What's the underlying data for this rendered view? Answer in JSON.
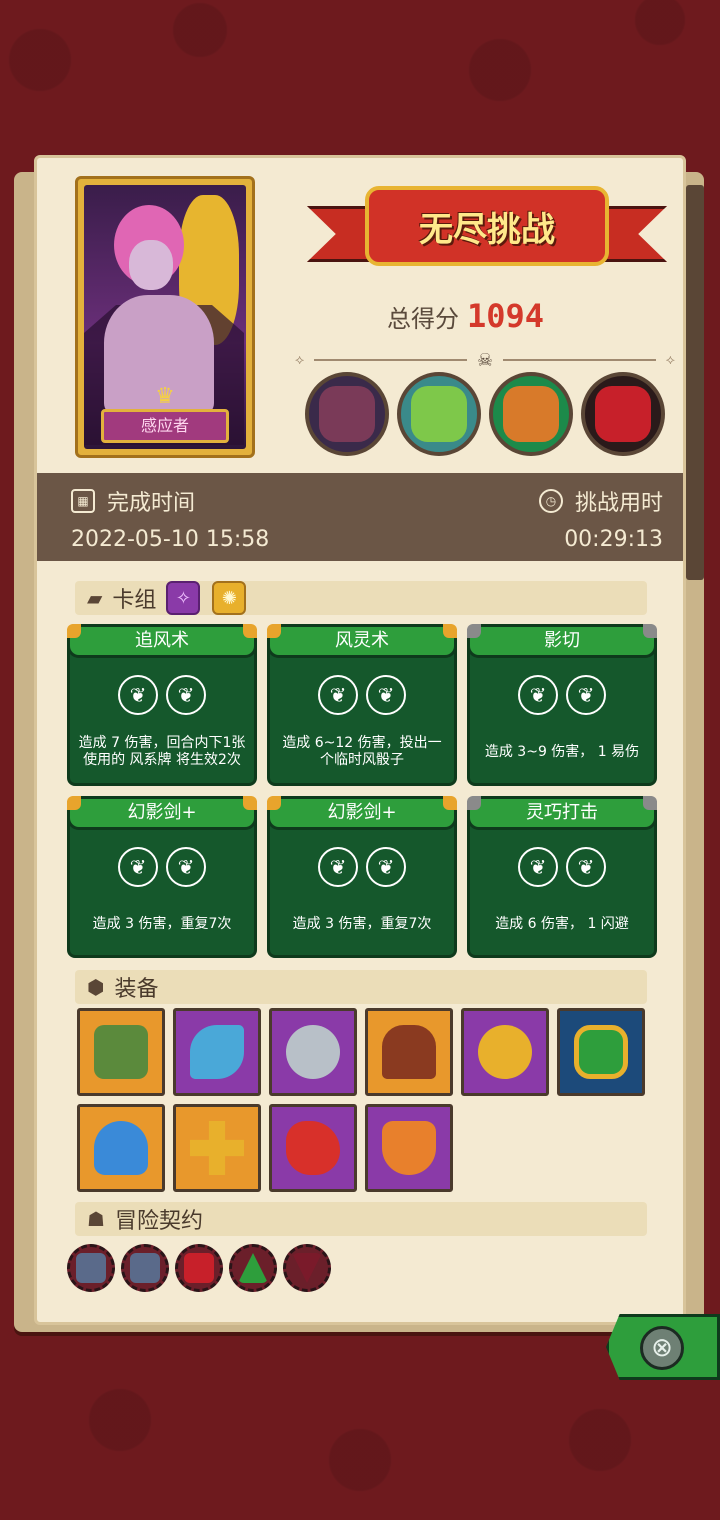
{
  "hero": {
    "name": "感应者",
    "crown_icon": "crown-icon"
  },
  "banner": {
    "title": "无尽挑战"
  },
  "score": {
    "label": "总得分",
    "value": "1094"
  },
  "bosses": [
    {
      "icon": "boss-stone-golem-icon",
      "color": "#7a3a58"
    },
    {
      "icon": "boss-dragon-icon",
      "color": "#7ec84a"
    },
    {
      "icon": "boss-fish-icon",
      "color": "#d87a2a"
    },
    {
      "icon": "boss-red-hat-icon",
      "color": "#c7202a"
    }
  ],
  "info": {
    "completion_label": "完成时间",
    "completion_value": "2022-05-10 15:58",
    "duration_label": "挑战用时",
    "duration_value": "00:29:13"
  },
  "deck": {
    "label": "卡组",
    "cards": [
      {
        "title": "追风术",
        "desc": "造成 7 伤害，回合内下1张使用的 风系牌 将生效2次",
        "corner": "gold"
      },
      {
        "title": "风灵术",
        "desc": "造成 6~12 伤害，投出一个临时风骰子",
        "corner": "gold"
      },
      {
        "title": "影切",
        "desc": "造成 3~9 伤害， 1 易伤",
        "corner": "gray"
      },
      {
        "title": "幻影剑+",
        "desc": "造成 3 伤害，重复7次",
        "corner": "gold"
      },
      {
        "title": "幻影剑+",
        "desc": "造成 3 伤害，重复7次",
        "corner": "gold"
      },
      {
        "title": "灵巧打击",
        "desc": "造成 6 伤害， 1 闪避",
        "corner": "gray"
      }
    ]
  },
  "equipment": {
    "label": "装备",
    "items": [
      {
        "icon": "green-book-icon",
        "bg": "#e8982c",
        "color": "#5b8a3c"
      },
      {
        "icon": "curved-blade-icon",
        "bg": "#8a3aa8",
        "color": "#4aa8d8"
      },
      {
        "icon": "silver-ring-icon",
        "bg": "#8a3aa8",
        "color": "#b8c0c8"
      },
      {
        "icon": "hood-icon",
        "bg": "#e8982c",
        "color": "#8a3a20"
      },
      {
        "icon": "gold-ring-icon",
        "bg": "#8a3aa8",
        "color": "#e8b02c"
      },
      {
        "icon": "emerald-amulet-icon",
        "bg": "#1c4a7a",
        "color": "#2e9e3c"
      },
      {
        "icon": "blue-mushroom-icon",
        "bg": "#e8982c",
        "color": "#3a8ad8"
      },
      {
        "icon": "golden-cross-icon",
        "bg": "#e8982c",
        "color": "#e8b02c"
      },
      {
        "icon": "red-potion-icon",
        "bg": "#8a3aa8",
        "color": "#d8302a"
      },
      {
        "icon": "fire-shield-icon",
        "bg": "#8a3aa8",
        "color": "#e8802c"
      }
    ]
  },
  "contracts": {
    "label": "冒险契约",
    "items": [
      {
        "icon": "sword-contract-icon",
        "color": "#5a6a8a"
      },
      {
        "icon": "book-contract-icon",
        "color": "#5a6a8a"
      },
      {
        "icon": "blood-contract-icon",
        "color": "#c7202a"
      },
      {
        "icon": "star-contract-icon",
        "color": "#2e9e3c"
      },
      {
        "icon": "shield-contract-icon",
        "color": "#7a1a2a"
      }
    ]
  },
  "close": {
    "icon": "close-icon",
    "glyph": "⊗"
  }
}
